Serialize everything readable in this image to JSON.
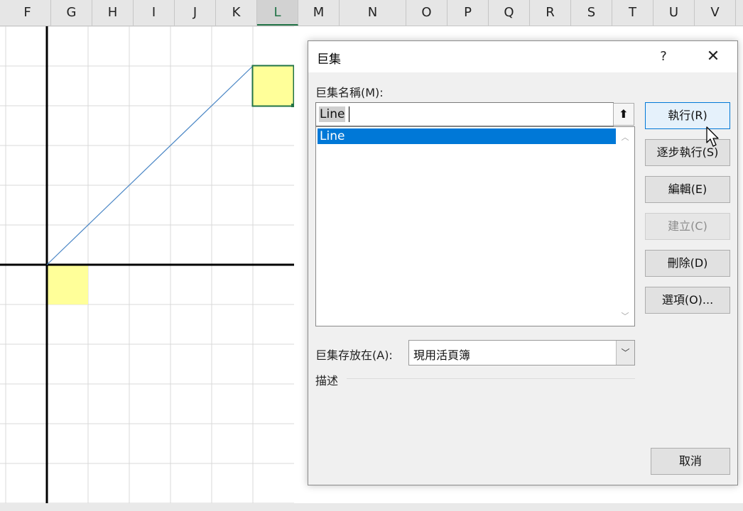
{
  "spreadsheet": {
    "columns": [
      {
        "label": "F",
        "active": false
      },
      {
        "label": "G",
        "active": false
      },
      {
        "label": "H",
        "active": false
      },
      {
        "label": "I",
        "active": false
      },
      {
        "label": "J",
        "active": false
      },
      {
        "label": "K",
        "active": false
      },
      {
        "label": "L",
        "active": true
      },
      {
        "label": "M",
        "active": false
      },
      {
        "label": "N",
        "active": false
      },
      {
        "label": "O",
        "active": false
      },
      {
        "label": "P",
        "active": false
      },
      {
        "label": "Q",
        "active": false
      },
      {
        "label": "R",
        "active": false
      },
      {
        "label": "S",
        "active": false
      },
      {
        "label": "T",
        "active": false
      },
      {
        "label": "U",
        "active": false
      },
      {
        "label": "V",
        "active": false
      }
    ],
    "highlight_color": "#ffff99",
    "selection_color": "#217346",
    "line_color": "#4a86c5"
  },
  "dialog": {
    "title": "巨集",
    "help_label": "?",
    "close_label": "✕",
    "macro_name_label": "巨集名稱(M):",
    "macro_name_value": "Line",
    "collapse_label": "⬆",
    "macro_list": [
      "Line"
    ],
    "location_label": "巨集存放在(A):",
    "location_value": "現用活頁簿",
    "description_label": "描述",
    "buttons": {
      "run": "執行(R)",
      "step_into": "逐步執行(S)",
      "edit": "編輯(E)",
      "create": "建立(C)",
      "delete": "刪除(D)",
      "options": "選項(O)...",
      "cancel": "取消"
    },
    "icons": {
      "help": "help-icon",
      "close": "close-icon",
      "collapse": "collapse-dialog-icon",
      "cursor": "mouse-pointer-icon"
    }
  }
}
